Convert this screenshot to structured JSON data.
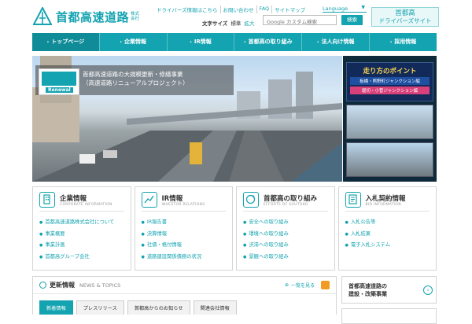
{
  "header": {
    "logo_text": "首都高速道路",
    "logo_sub": "株式会社",
    "top_links": [
      "ドライバーズ情報はこちら",
      "お問い合わせ",
      "FAQ",
      "サイトマップ"
    ],
    "language_label": "Language",
    "font_size_label": "文字サイズ",
    "font_size_standard": "標準",
    "font_size_large": "拡大",
    "search_placeholder": "Google カスタム検索",
    "search_button": "検索",
    "driver_site_line1": "首都高",
    "driver_site_line2": "ドライバーズサイト"
  },
  "nav": {
    "items": [
      {
        "label": "トップページ"
      },
      {
        "label": "企業情報"
      },
      {
        "label": "IR情報"
      },
      {
        "label": "首都高の取り組み"
      },
      {
        "label": "法人向け情報"
      },
      {
        "label": "採用情報"
      }
    ]
  },
  "hero": {
    "badge": "Renewal",
    "title_line1": "首都高速道路の大規模更新・修繕事業",
    "title_line2": "（高速道路リニューアルプロジェクト）"
  },
  "thumbs": {
    "point_title": "走り方のポイント",
    "point_sub1": "板橋・熊野町ジャンクション編",
    "point_sub2": "堀切・小菅ジャンクション編"
  },
  "categories": [
    {
      "title": "企業情報",
      "en": "CORPORATE INFORMATION",
      "items": [
        "首都高速道路株式会社について",
        "事業概要",
        "事業計画",
        "首都高グループ会社"
      ]
    },
    {
      "title": "IR情報",
      "en": "INVESTOR RELATIONS",
      "items": [
        "IR報告書",
        "決算情報",
        "社債・格付情報",
        "道路建設関係債務の状況"
      ]
    },
    {
      "title": "首都高の取り組み",
      "en": "EFFORTS OF SHUTOKO",
      "items": [
        "安全への取り組み",
        "環境への取り組み",
        "渋滞への取り組み",
        "景観への取り組み"
      ]
    },
    {
      "title": "入札契約情報",
      "en": "BID INFORMATION",
      "items": [
        "入札公告等",
        "入札結果",
        "電子入札システム"
      ]
    }
  ],
  "news": {
    "title": "更新情報",
    "en": "NEWS & TOPICS",
    "more": "一覧を見る",
    "tabs": [
      "新着情報",
      "プレスリリース",
      "首都高からのお知らせ",
      "関連会社情報"
    ]
  },
  "side": {
    "banner1_line1": "首都高速道路の",
    "banner1_line2": "建設・改築事業"
  },
  "colors": {
    "accent": "#14a3b0",
    "nav_active": "#0f8c98",
    "rss": "#f29a22"
  }
}
